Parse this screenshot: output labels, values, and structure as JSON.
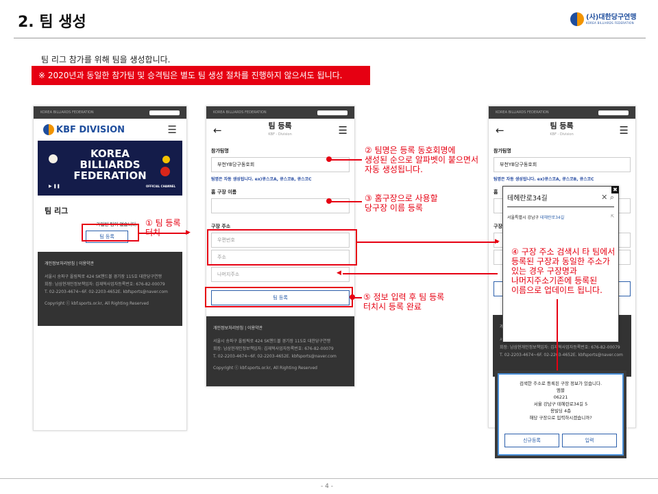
{
  "page": {
    "title": "2. 팀 생성",
    "page_number": "- 4 -",
    "intro": "팀 리그 참가를 위해 팀을 생성합니다.",
    "note": "※ 2020년과 동일한 참가팀 및 승격팀은 별도 팀 생성 절차를 진행하지 않으셔도 됩니다."
  },
  "logo": {
    "name": "(사)대한당구연맹",
    "sub": "KOREA BILLIARDS FEDERATION"
  },
  "phone1": {
    "bar_text": "KOREA BILLIARDS FEDERATION",
    "brand": "KBF DIVISION",
    "banner": [
      "KOREA",
      "BILLIARDS",
      "FEDERATION"
    ],
    "banner_badge": "OFFICIAL CHANNEL",
    "section": "팀 리그",
    "empty": "가입된 팀이 없습니다.",
    "btn": "팀 등록"
  },
  "footer": {
    "links": "개인정보처리방침 | 이용약관",
    "line1": "서울시 송파구 올림픽로 424 SK핸드볼 경기장 115호 대한당구연맹",
    "line2": "회장: 남삼현개인정보책임자: 김재혁사업자등록번호: 676-82-00079",
    "line3": "T. 02-2203-4674~6F. 02-2203-4652E. kbfsports@naver.com",
    "copy": "Copyright ⓒ kbf.sports.or.kr, All Righting Reserved"
  },
  "form": {
    "title": "팀 등록",
    "subtitle": "KBF - Division",
    "team_label": "참가팀명",
    "team_value": "부천YB당구동호회",
    "hint": "팀명은 자동 생성됩니다. ex)큐스코A, 큐스코B, 큐스코C",
    "home_label": "홈 구장 이름",
    "addr_label": "구장 주소",
    "postcode_ph": "우편번호",
    "addr_ph": "주소",
    "detail_ph": "나머지주소",
    "submit": "팀 등록"
  },
  "callouts": {
    "c1": [
      "① 팀 등록",
      "터치"
    ],
    "c2": [
      "② 팀명은 등록 동호회명에",
      "생성된 순으로 알파벳이 붙으면서",
      "자동 생성됩니다."
    ],
    "c3": [
      "③ 홈구장으로 사용할",
      "당구장 이름 등록"
    ],
    "c4": [
      "④ 구장 주소 검색시 타 팀에서",
      "등록된 구장과 동일한 주소가",
      "있는 경우 구장명과",
      "나머지주소기존에 등록된",
      "이름으로 업데이트 됩니다."
    ],
    "c5": [
      "⑤ 정보 입력 후 팀 등록",
      "터치시 등록 완료"
    ]
  },
  "search": {
    "value": "테헤란로34길",
    "result_prefix": "서울특별시 강남구",
    "result_highlight": "테헤란로34길"
  },
  "dialog": {
    "lines": [
      "검색한 주소로 등록된 구장 정보가 있습니다.",
      "엠블",
      "06221",
      "서울 강남구 테헤란로34길 5",
      "용빌딩 4층",
      "해당 구장으로 입력하시겠습니까?"
    ],
    "btn_new": "신규등록",
    "btn_ok": "입력"
  },
  "colors": {
    "accent": "#e60012",
    "brand_blue": "#1f4e9d",
    "button_blue": "#2b5fab"
  }
}
